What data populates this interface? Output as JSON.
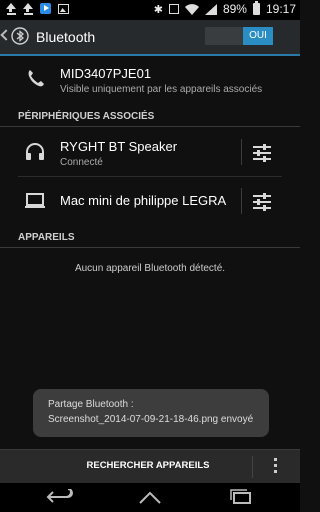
{
  "status_bar": {
    "battery": "89%",
    "time": "19:17"
  },
  "action_bar": {
    "title": "Bluetooth",
    "toggle_label": "OUI"
  },
  "device": {
    "name": "MID3407PJE01",
    "visibility": "Visible uniquement par les appareils associés"
  },
  "paired": {
    "header": "PÉRIPHÉRIQUES ASSOCIÉS",
    "items": [
      {
        "name": "RYGHT BT Speaker",
        "status": "Connecté",
        "icon": "headphones-icon"
      },
      {
        "name": "Mac mini de philippe LEGRA",
        "status": "",
        "icon": "laptop-icon"
      }
    ]
  },
  "available": {
    "header": "APPAREILS",
    "empty_message": "Aucun appareil Bluetooth détecté."
  },
  "toast": {
    "line1": "Partage Bluetooth :",
    "line2": "Screenshot_2014-07-09-21-18-46.png envoyé"
  },
  "bottom": {
    "scan_label": "RECHERCHER APPAREILS"
  },
  "colors": {
    "accent": "#2a8ec4",
    "background": "#101010",
    "action_bar": "#272a2d"
  }
}
